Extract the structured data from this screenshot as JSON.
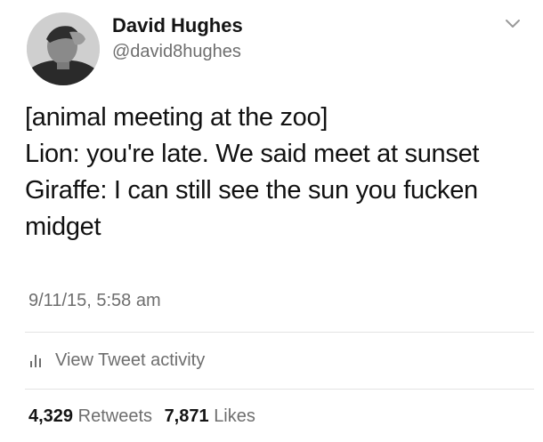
{
  "author": {
    "name": "David Hughes",
    "handle": "@david8hughes",
    "avatar_icon": "profile-photo-avatar"
  },
  "menu_icon": "chevron-down-icon",
  "tweet": {
    "lines": [
      "[animal meeting at the zoo]",
      "Lion: you're late. We said meet at sunset",
      "Giraffe: I can still see the sun you fucken",
      "midget"
    ]
  },
  "timestamp": "9/11/15, 5:58 am",
  "activity": {
    "icon": "bar-chart-icon",
    "label": "View Tweet activity"
  },
  "stats": {
    "retweets": {
      "count": "4,329",
      "label": "Retweets"
    },
    "likes": {
      "count": "7,871",
      "label": "Likes"
    }
  },
  "colors": {
    "text_primary": "#111111",
    "text_secondary": "#6e6e6e",
    "divider": "#e3e3e3",
    "background": "#ffffff"
  }
}
